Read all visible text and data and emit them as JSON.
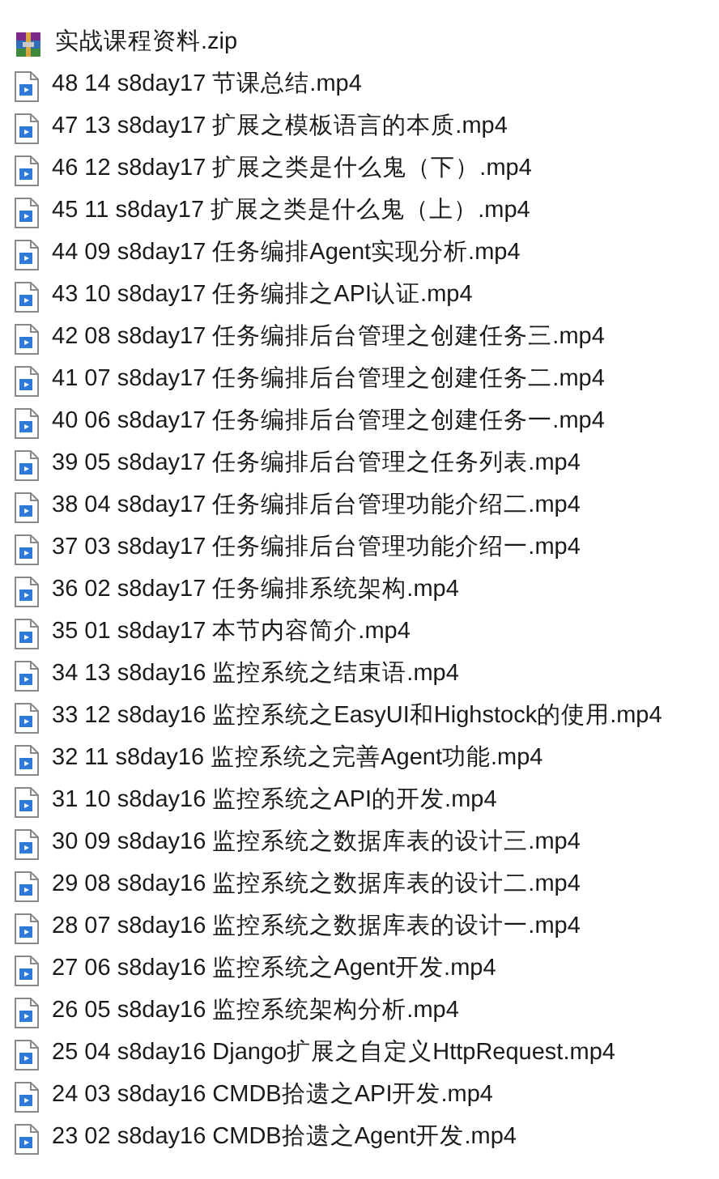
{
  "files": [
    {
      "kind": "archive",
      "name": "实战课程资料.zip"
    },
    {
      "kind": "video",
      "name": "48 14 s8day17 节课总结.mp4"
    },
    {
      "kind": "video",
      "name": "47 13 s8day17 扩展之模板语言的本质.mp4"
    },
    {
      "kind": "video",
      "name": "46 12 s8day17 扩展之类是什么鬼（下）.mp4"
    },
    {
      "kind": "video",
      "name": "45 11 s8day17 扩展之类是什么鬼（上）.mp4"
    },
    {
      "kind": "video",
      "name": "44 09 s8day17 任务编排Agent实现分析.mp4"
    },
    {
      "kind": "video",
      "name": "43 10 s8day17 任务编排之API认证.mp4"
    },
    {
      "kind": "video",
      "name": "42 08 s8day17 任务编排后台管理之创建任务三.mp4"
    },
    {
      "kind": "video",
      "name": "41 07 s8day17 任务编排后台管理之创建任务二.mp4"
    },
    {
      "kind": "video",
      "name": "40 06 s8day17 任务编排后台管理之创建任务一.mp4"
    },
    {
      "kind": "video",
      "name": "39 05 s8day17 任务编排后台管理之任务列表.mp4"
    },
    {
      "kind": "video",
      "name": "38 04 s8day17 任务编排后台管理功能介绍二.mp4"
    },
    {
      "kind": "video",
      "name": "37 03 s8day17 任务编排后台管理功能介绍一.mp4"
    },
    {
      "kind": "video",
      "name": "36 02 s8day17 任务编排系统架构.mp4"
    },
    {
      "kind": "video",
      "name": "35 01 s8day17 本节内容简介.mp4"
    },
    {
      "kind": "video",
      "name": "34 13 s8day16 监控系统之结束语.mp4"
    },
    {
      "kind": "video",
      "name": "33 12 s8day16 监控系统之EasyUI和Highstock的使用.mp4"
    },
    {
      "kind": "video",
      "name": "32 11 s8day16 监控系统之完善Agent功能.mp4"
    },
    {
      "kind": "video",
      "name": "31 10 s8day16 监控系统之API的开发.mp4"
    },
    {
      "kind": "video",
      "name": "30 09 s8day16 监控系统之数据库表的设计三.mp4"
    },
    {
      "kind": "video",
      "name": "29 08 s8day16 监控系统之数据库表的设计二.mp4"
    },
    {
      "kind": "video",
      "name": "28 07 s8day16 监控系统之数据库表的设计一.mp4"
    },
    {
      "kind": "video",
      "name": "27 06 s8day16 监控系统之Agent开发.mp4"
    },
    {
      "kind": "video",
      "name": "26 05 s8day16 监控系统架构分析.mp4"
    },
    {
      "kind": "video",
      "name": "25 04 s8day16 Django扩展之自定义HttpRequest.mp4"
    },
    {
      "kind": "video",
      "name": "24 03 s8day16 CMDB拾遗之API开发.mp4"
    },
    {
      "kind": "video",
      "name": "23 02 s8day16 CMDB拾遗之Agent开发.mp4"
    }
  ]
}
